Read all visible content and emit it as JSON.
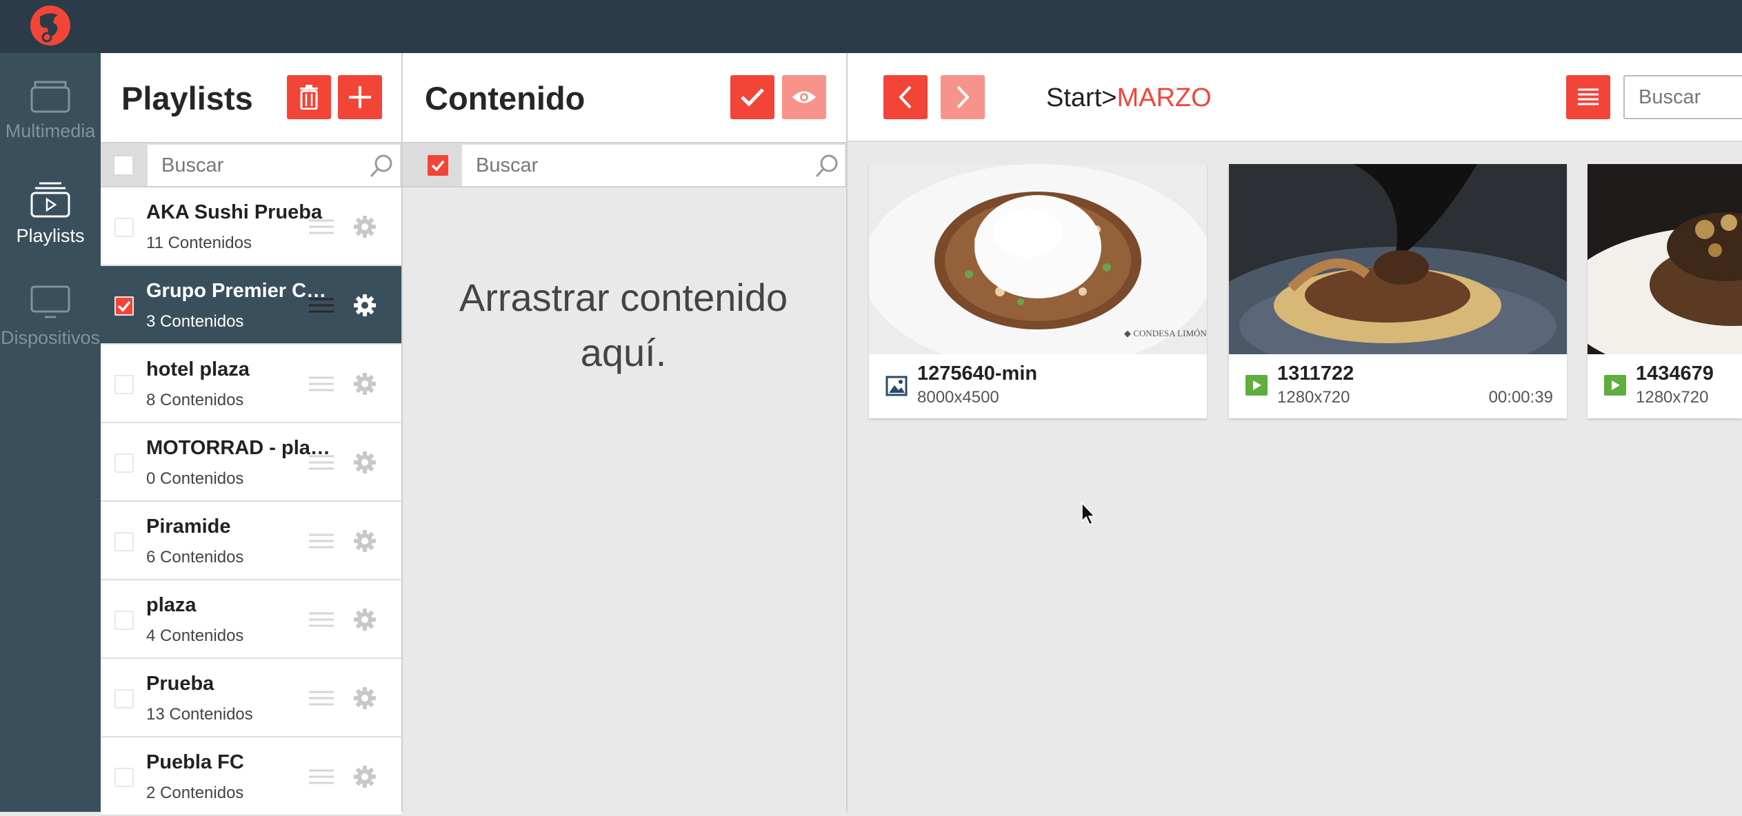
{
  "rail": {
    "items": [
      {
        "label": "Multimedia",
        "icon": "folder-icon"
      },
      {
        "label": "Playlists",
        "icon": "playlist-icon"
      },
      {
        "label": "Dispositivos",
        "icon": "monitor-icon"
      }
    ]
  },
  "playlists": {
    "title": "Playlists",
    "search_placeholder": "Buscar",
    "items": [
      {
        "name": "AKA Sushi Prueba",
        "count": "11 Contenidos",
        "selected": false
      },
      {
        "name": "Grupo Premier Corporativo",
        "count": "3 Contenidos",
        "selected": true
      },
      {
        "name": "hotel plaza",
        "count": "8 Contenidos",
        "selected": false
      },
      {
        "name": "MOTORRAD - playlist",
        "count": "0 Contenidos",
        "selected": false
      },
      {
        "name": "Piramide",
        "count": "6 Contenidos",
        "selected": false
      },
      {
        "name": "plaza",
        "count": "4 Contenidos",
        "selected": false
      },
      {
        "name": "Prueba",
        "count": "13 Contenidos",
        "selected": false
      },
      {
        "name": "Puebla FC",
        "count": "2 Contenidos",
        "selected": false
      }
    ]
  },
  "content": {
    "title": "Contenido",
    "search_placeholder": "Buscar",
    "drop_hint": "Arrastrar contenido aquí."
  },
  "browser": {
    "breadcrumb_root": "Start>",
    "breadcrumb_current": "MARZO",
    "search_placeholder": "Buscar",
    "cards": [
      {
        "title": "1275640-min",
        "dims": "8000x4500",
        "duration": "",
        "kind": "image-icon"
      },
      {
        "title": "1311722",
        "dims": "1280x720",
        "duration": "00:00:39",
        "kind": "video-icon"
      },
      {
        "title": "1434679",
        "dims": "1280x720",
        "duration": "",
        "kind": "video-icon"
      }
    ]
  },
  "colors": {
    "accent": "#f34438",
    "accent_faded": "#f7938a",
    "sidebar": "#3a4f5c",
    "topbar": "#2b3b47",
    "video_badge": "#5fae3e"
  }
}
